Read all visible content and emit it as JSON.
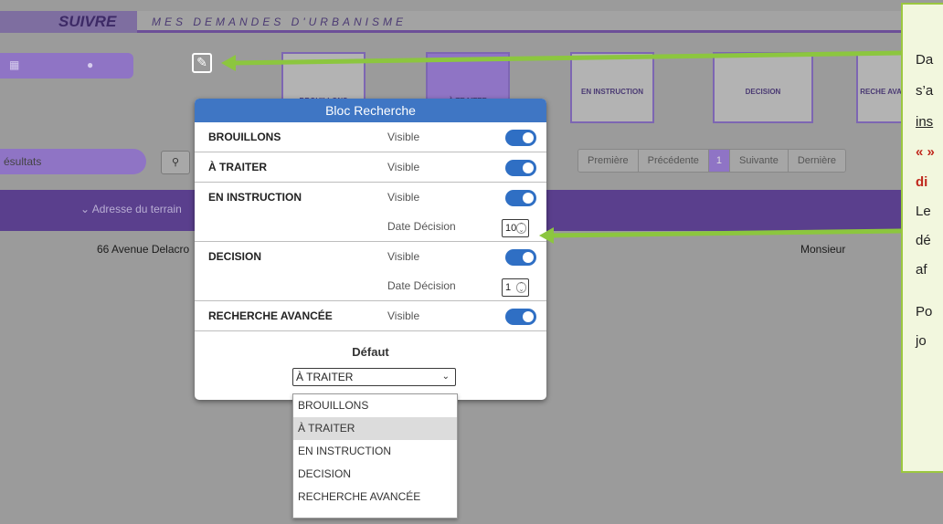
{
  "app": {
    "module": "SUIVRE",
    "title": "MES DEMANDES D'URBANISME"
  },
  "tabs": [
    {
      "label": "BROUILLONS"
    },
    {
      "label": "À TRAITER"
    },
    {
      "label": "EN INSTRUCTION"
    },
    {
      "label": "DECISION"
    },
    {
      "label": "RECHE AVAN"
    }
  ],
  "search": {
    "placeholder": "ésultats"
  },
  "pager": {
    "first": "Première",
    "prev": "Précédente",
    "page": "1",
    "next": "Suivante",
    "last": "Dernière"
  },
  "table": {
    "col_address": "Adresse du terrain",
    "row_address": "66 Avenue Delacro",
    "row_person": "Monsieur"
  },
  "modal": {
    "title": "Bloc Recherche",
    "rows": [
      {
        "name": "BROUILLONS",
        "visible_label": "Visible",
        "visible": true
      },
      {
        "name": "À TRAITER",
        "visible_label": "Visible",
        "visible": true
      },
      {
        "name": "EN INSTRUCTION",
        "visible_label": "Visible",
        "visible": true,
        "date_label": "Date Décision",
        "date_value": "10"
      },
      {
        "name": "DECISION",
        "visible_label": "Visible",
        "visible": true,
        "date_label": "Date Décision",
        "date_value": "1"
      },
      {
        "name": "RECHERCHE AVANCÉE",
        "visible_label": "Visible",
        "visible": true
      }
    ],
    "default_label": "Défaut",
    "default_value": "À TRAITER",
    "options": [
      "BROUILLONS",
      "À TRAITER",
      "EN INSTRUCTION",
      "DECISION",
      "RECHERCHE AVANCÉE"
    ]
  },
  "note": {
    "line1": "Da",
    "line2": "s’a",
    "line3": "ins",
    "line4": "« »",
    "line5": "di",
    "line6": "Le",
    "line7": "dé",
    "line8": "af",
    "line9": "Po",
    "line10": "jo"
  },
  "colors": {
    "accent": "#3f76c4",
    "purple": "#8f74c5",
    "arrow": "#8cc63f"
  }
}
